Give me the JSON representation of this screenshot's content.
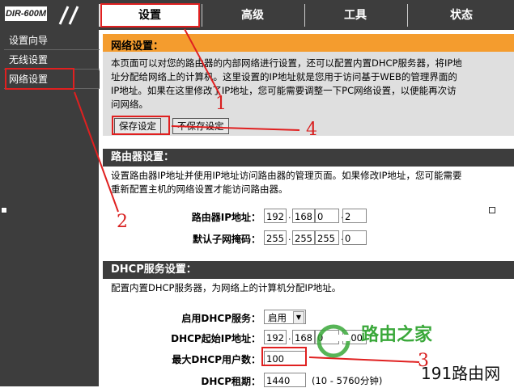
{
  "header": {
    "logo": "DIR-600M",
    "tabs": [
      {
        "label": "设置",
        "active": true
      },
      {
        "label": "高级",
        "active": false
      },
      {
        "label": "工具",
        "active": false
      },
      {
        "label": "状态",
        "active": false
      }
    ]
  },
  "sidebar": {
    "items": [
      {
        "label": "设置向导"
      },
      {
        "label": "无线设置"
      },
      {
        "label": "网络设置",
        "selected": true
      }
    ]
  },
  "network": {
    "title": "网络设置：",
    "description": "本页面可以对您的路由器的内部网络进行设置，还可以配置内置DHCP服务器，将IP地\n址分配给网络上的计算机。这里设置的IP地址就是您用于访问基于WEB的管理界面的\nIP地址。如果在这里修改了IP地址，您可能需要调整一下PC网络设置，以便能再次访\n问网络。",
    "save_label": "保存设定",
    "nosave_label": "不保存设定"
  },
  "router": {
    "title": "路由器设置：",
    "description": "设置路由器IP地址并使用IP地址访问路由器的管理页面。如果修改IP地址，您可能需要\n重新配置主机的网络设置才能访问路由器。",
    "ip_label": "路由器IP地址：",
    "ip": [
      "192",
      "168",
      "0",
      "2"
    ],
    "mask_label": "默认子网掩码：",
    "mask": [
      "255",
      "255",
      "255",
      "0"
    ]
  },
  "dhcp": {
    "title": "DHCP服务设置：",
    "description": "配置内置DHCP服务器，为网络上的计算机分配IP地址。",
    "enable_label": "启用DHCP服务：",
    "enable_value": "启用",
    "start_label": "DHCP起始IP地址：",
    "start_ip": [
      "192",
      "168",
      "0",
      "100"
    ],
    "max_label": "最大DHCP用户数：",
    "max_value": "100",
    "lease_label": "DHCP租期：",
    "lease_value": "1440",
    "lease_hint": "(10 - 5760分钟)"
  },
  "annotations": [
    "1",
    "2",
    "3",
    "4"
  ],
  "watermark": {
    "text1": "路由之家",
    "text2": "191路由网"
  },
  "colors": {
    "accent_orange": "#f49c2e",
    "dark": "#3d3d3d",
    "annotation_red": "#e02020"
  }
}
